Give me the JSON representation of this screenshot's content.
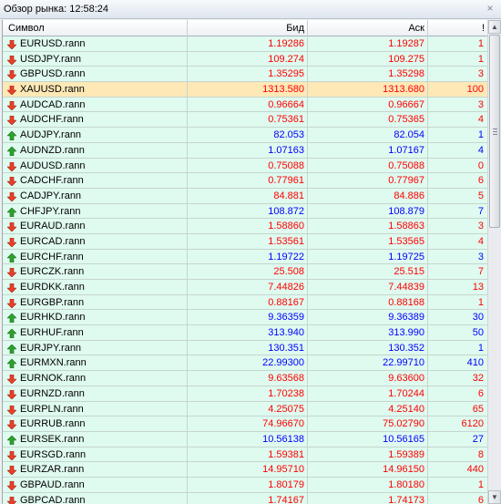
{
  "window": {
    "title": "Обзор рынка: 12:58:24"
  },
  "colors": {
    "red": "#ff0000",
    "blue": "#0000ff",
    "row_bg": "#dffaef",
    "selected_bg": "#fde8b6"
  },
  "table": {
    "headers": {
      "symbol": "Символ",
      "bid": "Бид",
      "ask": "Аск",
      "spread": "!"
    },
    "rows": [
      {
        "symbol": "EURUSD.rann",
        "bid": "1.19286",
        "ask": "1.19287",
        "spread": "1",
        "dir": "down",
        "color": "red"
      },
      {
        "symbol": "USDJPY.rann",
        "bid": "109.274",
        "ask": "109.275",
        "spread": "1",
        "dir": "down",
        "color": "red"
      },
      {
        "symbol": "GBPUSD.rann",
        "bid": "1.35295",
        "ask": "1.35298",
        "spread": "3",
        "dir": "down",
        "color": "red"
      },
      {
        "symbol": "XAUUSD.rann",
        "bid": "1313.580",
        "ask": "1313.680",
        "spread": "100",
        "dir": "down",
        "color": "red",
        "selected": true
      },
      {
        "symbol": "AUDCAD.rann",
        "bid": "0.96664",
        "ask": "0.96667",
        "spread": "3",
        "dir": "down",
        "color": "red"
      },
      {
        "symbol": "AUDCHF.rann",
        "bid": "0.75361",
        "ask": "0.75365",
        "spread": "4",
        "dir": "down",
        "color": "red"
      },
      {
        "symbol": "AUDJPY.rann",
        "bid": "82.053",
        "ask": "82.054",
        "spread": "1",
        "dir": "up",
        "color": "blue"
      },
      {
        "symbol": "AUDNZD.rann",
        "bid": "1.07163",
        "ask": "1.07167",
        "spread": "4",
        "dir": "up",
        "color": "blue"
      },
      {
        "symbol": "AUDUSD.rann",
        "bid": "0.75088",
        "ask": "0.75088",
        "spread": "0",
        "dir": "down",
        "color": "red"
      },
      {
        "symbol": "CADCHF.rann",
        "bid": "0.77961",
        "ask": "0.77967",
        "spread": "6",
        "dir": "down",
        "color": "red"
      },
      {
        "symbol": "CADJPY.rann",
        "bid": "84.881",
        "ask": "84.886",
        "spread": "5",
        "dir": "down",
        "color": "red"
      },
      {
        "symbol": "CHFJPY.rann",
        "bid": "108.872",
        "ask": "108.879",
        "spread": "7",
        "dir": "up",
        "color": "blue"
      },
      {
        "symbol": "EURAUD.rann",
        "bid": "1.58860",
        "ask": "1.58863",
        "spread": "3",
        "dir": "down",
        "color": "red"
      },
      {
        "symbol": "EURCAD.rann",
        "bid": "1.53561",
        "ask": "1.53565",
        "spread": "4",
        "dir": "down",
        "color": "red"
      },
      {
        "symbol": "EURCHF.rann",
        "bid": "1.19722",
        "ask": "1.19725",
        "spread": "3",
        "dir": "up",
        "color": "blue"
      },
      {
        "symbol": "EURCZK.rann",
        "bid": "25.508",
        "ask": "25.515",
        "spread": "7",
        "dir": "down",
        "color": "red"
      },
      {
        "symbol": "EURDKK.rann",
        "bid": "7.44826",
        "ask": "7.44839",
        "spread": "13",
        "dir": "down",
        "color": "red"
      },
      {
        "symbol": "EURGBP.rann",
        "bid": "0.88167",
        "ask": "0.88168",
        "spread": "1",
        "dir": "down",
        "color": "red"
      },
      {
        "symbol": "EURHKD.rann",
        "bid": "9.36359",
        "ask": "9.36389",
        "spread": "30",
        "dir": "up",
        "color": "blue"
      },
      {
        "symbol": "EURHUF.rann",
        "bid": "313.940",
        "ask": "313.990",
        "spread": "50",
        "dir": "up",
        "color": "blue"
      },
      {
        "symbol": "EURJPY.rann",
        "bid": "130.351",
        "ask": "130.352",
        "spread": "1",
        "dir": "up",
        "color": "blue"
      },
      {
        "symbol": "EURMXN.rann",
        "bid": "22.99300",
        "ask": "22.99710",
        "spread": "410",
        "dir": "up",
        "color": "blue"
      },
      {
        "symbol": "EURNOK.rann",
        "bid": "9.63568",
        "ask": "9.63600",
        "spread": "32",
        "dir": "down",
        "color": "red"
      },
      {
        "symbol": "EURNZD.rann",
        "bid": "1.70238",
        "ask": "1.70244",
        "spread": "6",
        "dir": "down",
        "color": "red"
      },
      {
        "symbol": "EURPLN.rann",
        "bid": "4.25075",
        "ask": "4.25140",
        "spread": "65",
        "dir": "down",
        "color": "red"
      },
      {
        "symbol": "EURRUB.rann",
        "bid": "74.96670",
        "ask": "75.02790",
        "spread": "6120",
        "dir": "down",
        "color": "red"
      },
      {
        "symbol": "EURSEK.rann",
        "bid": "10.56138",
        "ask": "10.56165",
        "spread": "27",
        "dir": "up",
        "color": "blue"
      },
      {
        "symbol": "EURSGD.rann",
        "bid": "1.59381",
        "ask": "1.59389",
        "spread": "8",
        "dir": "down",
        "color": "red"
      },
      {
        "symbol": "EURZAR.rann",
        "bid": "14.95710",
        "ask": "14.96150",
        "spread": "440",
        "dir": "down",
        "color": "red"
      },
      {
        "symbol": "GBPAUD.rann",
        "bid": "1.80179",
        "ask": "1.80180",
        "spread": "1",
        "dir": "down",
        "color": "red"
      },
      {
        "symbol": "GBPCAD.rann",
        "bid": "1.74167",
        "ask": "1.74173",
        "spread": "6",
        "dir": "down",
        "color": "red"
      }
    ]
  }
}
